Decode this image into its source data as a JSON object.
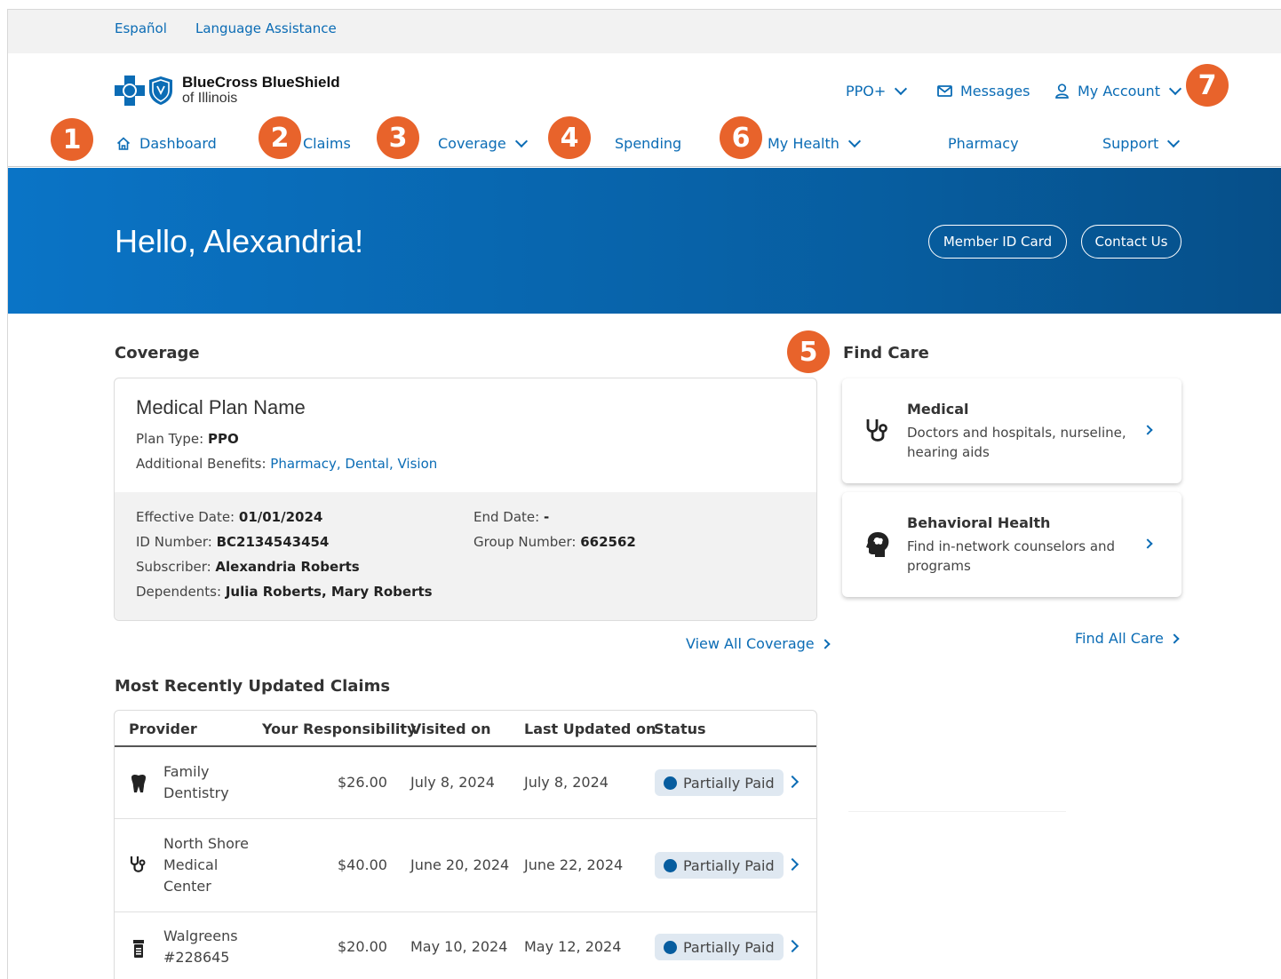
{
  "utility": {
    "lang_es": "Español",
    "lang_assist": "Language Assistance"
  },
  "brand": {
    "name": "BlueCross BlueShield",
    "sub": "of Illinois"
  },
  "topnav": {
    "plan": "PPO+",
    "messages": "Messages",
    "account": "My Account"
  },
  "nav": {
    "dashboard": "Dashboard",
    "claims": "Claims",
    "coverage": "Coverage",
    "spending": "Spending",
    "my_health": "My Health",
    "pharmacy": "Pharmacy",
    "support": "Support"
  },
  "badges": {
    "b1": "1",
    "b2": "2",
    "b3": "3",
    "b4": "4",
    "b5": "5",
    "b6": "6",
    "b7": "7"
  },
  "hero": {
    "greeting": "Hello, Alexandria!",
    "id_card": "Member ID Card",
    "contact": "Contact Us"
  },
  "coverage": {
    "section_title": "Coverage",
    "plan_name": "Medical Plan Name",
    "plan_type_label": "Plan Type: ",
    "plan_type": "PPO",
    "benefits_label": "Additional Benefits: ",
    "benefit_pharmacy": "Pharmacy",
    "benefit_dental": "Dental",
    "benefit_vision": "Vision",
    "effective_label": "Effective Date: ",
    "effective": "01/01/2024",
    "end_label": "End Date: ",
    "end": "-",
    "id_label": "ID Number: ",
    "id": "BC2134543454",
    "group_label": "Group Number: ",
    "group": "662562",
    "subscriber_label": "Subscriber: ",
    "subscriber": "Alexandria Roberts",
    "dependents_label": "Dependents: ",
    "dependents": "Julia Roberts, Mary Roberts",
    "view_all": "View All Coverage"
  },
  "find_care": {
    "section_title": "Find Care",
    "medical_title": "Medical",
    "medical_desc": "Doctors and hospitals, nurseline, hearing aids",
    "behavioral_title": "Behavioral Health",
    "behavioral_desc": "Find in-network counselors and programs",
    "find_all": "Find All Care"
  },
  "claims": {
    "section_title": "Most Recently Updated Claims",
    "headers": {
      "provider": "Provider",
      "responsibility": "Your Responsibility",
      "visited": "Visited on",
      "updated": "Last Updated on",
      "status": "Status"
    },
    "rows": [
      {
        "icon": "tooth-icon",
        "provider": "Family Dentistry",
        "amount": "$26.00",
        "visited": "July 8, 2024",
        "updated": "July 8, 2024",
        "status": "Partially Paid"
      },
      {
        "icon": "stethoscope-icon",
        "provider": "North Shore Medical Center",
        "amount": "$40.00",
        "visited": "June 20, 2024",
        "updated": "June 22, 2024",
        "status": "Partially Paid"
      },
      {
        "icon": "pill-bottle-icon",
        "provider": "Walgreens #228645",
        "amount": "$20.00",
        "visited": "May 10, 2024",
        "updated": "May 12, 2024",
        "status": "Partially Paid"
      }
    ]
  },
  "colors": {
    "brand_blue": "#0b6cb5",
    "badge_orange": "#e8632b",
    "hero_dark": "#064f89"
  }
}
